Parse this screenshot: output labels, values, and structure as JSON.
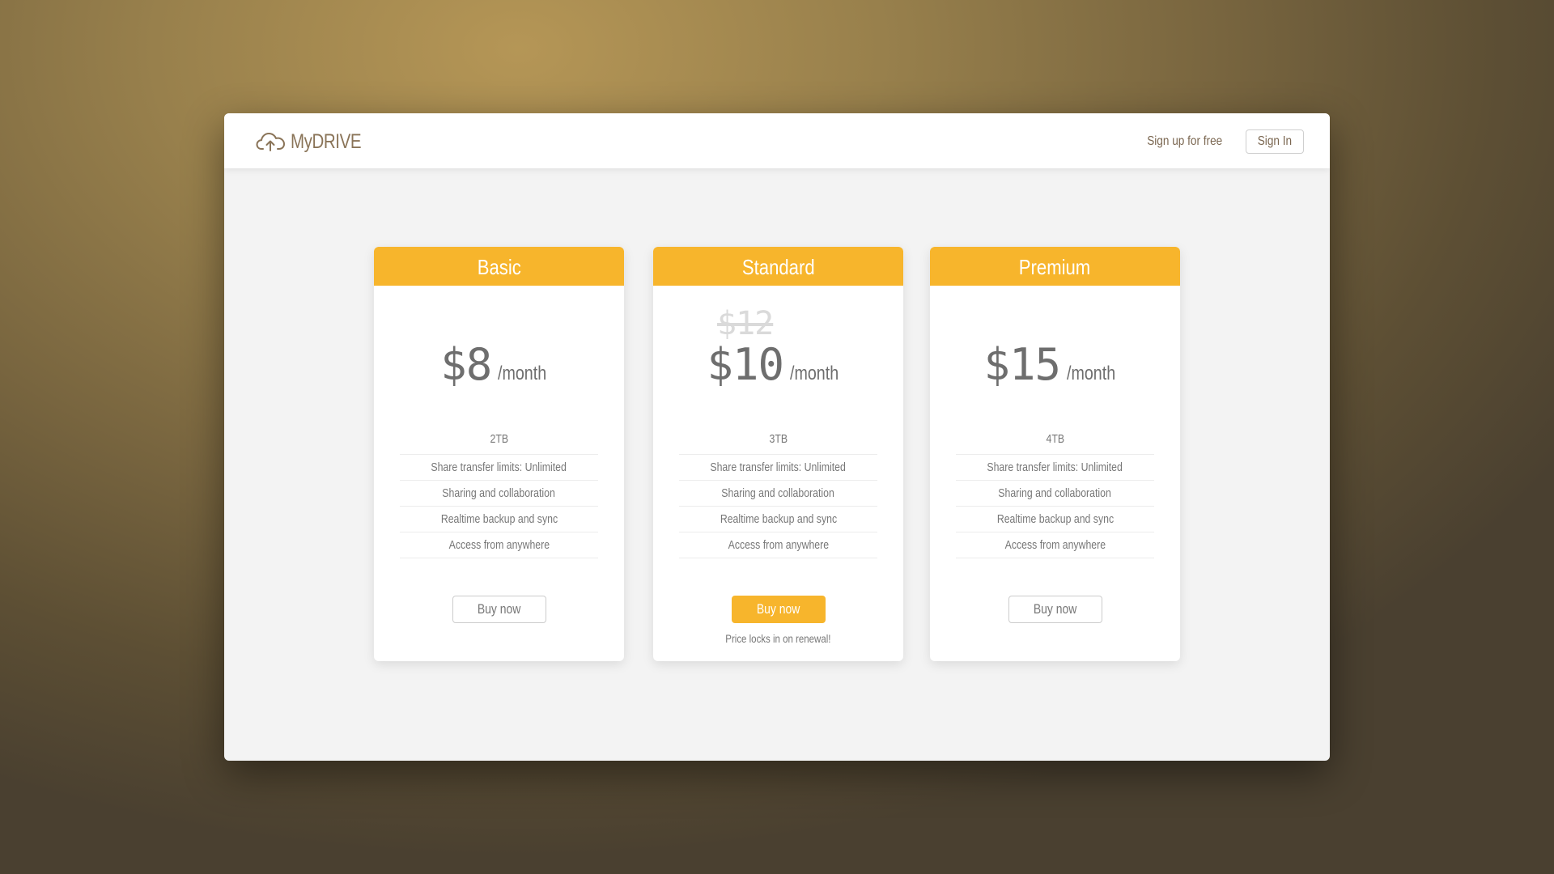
{
  "brand": {
    "name": "MyDRIVE",
    "icon": "cloud-upload-icon"
  },
  "nav": {
    "signup_label": "Sign up for free",
    "signin_label": "Sign In"
  },
  "colors": {
    "accent": "#f7b52c",
    "brand_text": "#8a7458",
    "page_bg": "#f3f3f3"
  },
  "plans": [
    {
      "name": "Basic",
      "price": "$8",
      "period": "/month",
      "features": [
        "2TB",
        "Share transfer limits: Unlimited",
        "Sharing and collaboration",
        "Realtime backup and sync",
        "Access from anywhere"
      ],
      "button_label": "Buy now"
    },
    {
      "name": "Standard",
      "old_price": "$12",
      "price": "$10",
      "period": "/month",
      "features": [
        "3TB",
        "Share transfer limits: Unlimited",
        "Sharing and collaboration",
        "Realtime backup and sync",
        "Access from anywhere"
      ],
      "button_label": "Buy now",
      "note": "Price locks in on renewal!"
    },
    {
      "name": "Premium",
      "price": "$15",
      "period": "/month",
      "features": [
        "4TB",
        "Share transfer limits: Unlimited",
        "Sharing and collaboration",
        "Realtime backup and sync",
        "Access from anywhere"
      ],
      "button_label": "Buy now"
    }
  ]
}
